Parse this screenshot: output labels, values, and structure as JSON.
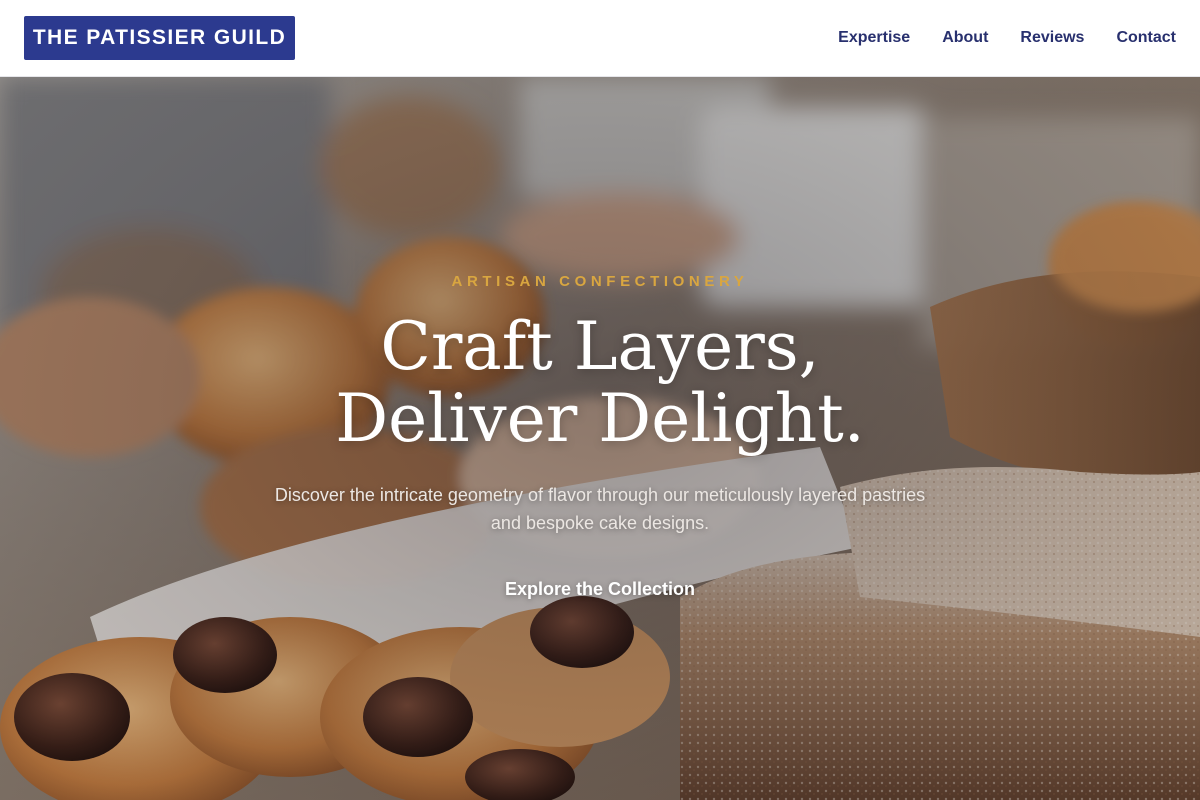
{
  "header": {
    "logo_text": "THE PATISSIER GUILD",
    "nav": [
      {
        "label": "Expertise"
      },
      {
        "label": "About"
      },
      {
        "label": "Reviews"
      },
      {
        "label": "Contact"
      }
    ]
  },
  "hero": {
    "eyebrow": "ARTISAN CONFECTIONERY",
    "headline_line1": "Craft Layers,",
    "headline_line2": "Deliver Delight.",
    "subtitle": "Discover the intricate geometry of flavor through our meticulously layered pastries and bespoke cake designs.",
    "cta_label": "Explore the Collection",
    "image_subject": "bakery display with pastries and crumb cake"
  },
  "colors": {
    "brand": "#2c3a8f",
    "nav_text": "#28306e",
    "accent_gold": "#d9a640",
    "hero_text": "#ffffff"
  }
}
